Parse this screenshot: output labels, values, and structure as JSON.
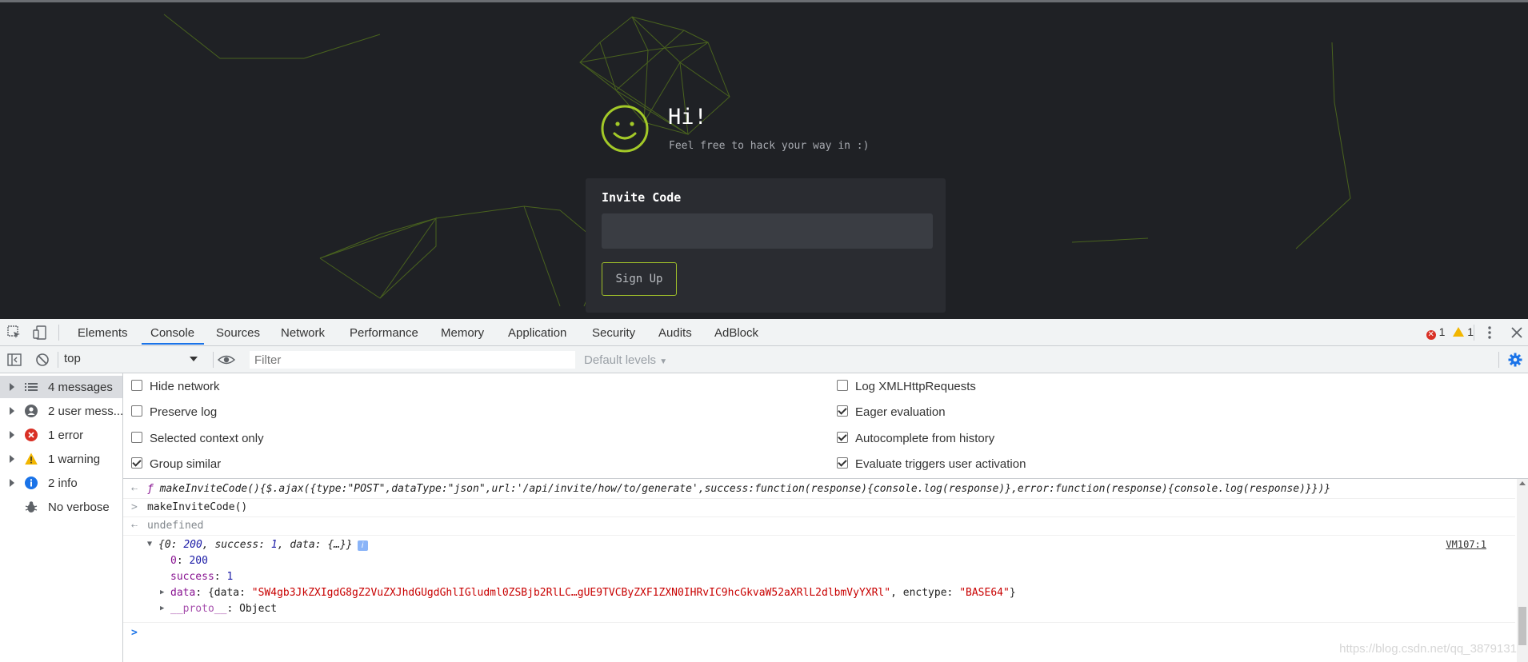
{
  "page": {
    "heading": "Hi!",
    "subheading": "Feel free to hack your way in :)",
    "form": {
      "label": "Invite Code",
      "input_value": "",
      "submit_label": "Sign Up"
    },
    "colors": {
      "background": "#1f2125",
      "accent": "#9fbf2a",
      "card": "#2a2c31"
    }
  },
  "devtools": {
    "tabs": [
      "Elements",
      "Console",
      "Sources",
      "Network",
      "Performance",
      "Memory",
      "Application",
      "Security",
      "Audits",
      "AdBlock"
    ],
    "active_tab": "Console",
    "error_count": "1",
    "warning_count": "1",
    "toolbar": {
      "context": "top",
      "filter_placeholder": "Filter",
      "levels": "Default levels"
    },
    "sidebar": [
      {
        "label": "4 messages",
        "icon": "list-icon"
      },
      {
        "label": "2 user mess...",
        "icon": "user-icon"
      },
      {
        "label": "1 error",
        "icon": "error-icon"
      },
      {
        "label": "1 warning",
        "icon": "warning-icon"
      },
      {
        "label": "2 info",
        "icon": "info-icon"
      },
      {
        "label": "No verbose",
        "icon": "bug-icon"
      }
    ],
    "settings_left": [
      {
        "label": "Hide network",
        "checked": false
      },
      {
        "label": "Preserve log",
        "checked": false
      },
      {
        "label": "Selected context only",
        "checked": false
      },
      {
        "label": "Group similar",
        "checked": true
      }
    ],
    "settings_right": [
      {
        "label": "Log XMLHttpRequests",
        "checked": false
      },
      {
        "label": "Eager evaluation",
        "checked": true
      },
      {
        "label": "Autocomplete from history",
        "checked": true
      },
      {
        "label": "Evaluate triggers user activation",
        "checked": true
      }
    ],
    "console": {
      "line1_f": "ƒ",
      "line1_code": "makeInviteCode(){$.ajax({type:\"POST\",dataType:\"json\",url:'/api/invite/how/to/generate',success:function(response){console.log(response)},error:function(response){console.log(response)}})}",
      "line2": "makeInviteCode()",
      "line3": "undefined",
      "obj_summary_pre": "{0: ",
      "obj_summary_200": "200",
      "obj_summary_mid": ", success: ",
      "obj_summary_1": "1",
      "obj_summary_post": ", data: {…}}",
      "source_link": "VM107:1",
      "prop0_key": "0",
      "prop0_val": "200",
      "prop_success_key": "success",
      "prop_success_val": "1",
      "prop_data_key": "data",
      "prop_data_pre": "{data: ",
      "prop_data_str": "\"SW4gb3JkZXIgdG8gZ2VuZXJhdGUgdGhlIGludml0ZSBjb2RlLC…gUE9TVCByZXF1ZXN0IHRvIC9hcGkvaW52aXRlL2dlbmVyYXRl\"",
      "prop_data_mid": ", enctype: ",
      "prop_data_enc": "\"BASE64\"",
      "prop_data_post": "}",
      "proto_key": "__proto__",
      "proto_val": "Object"
    },
    "watermark": "https://blog.csdn.net/qq_3879131"
  }
}
